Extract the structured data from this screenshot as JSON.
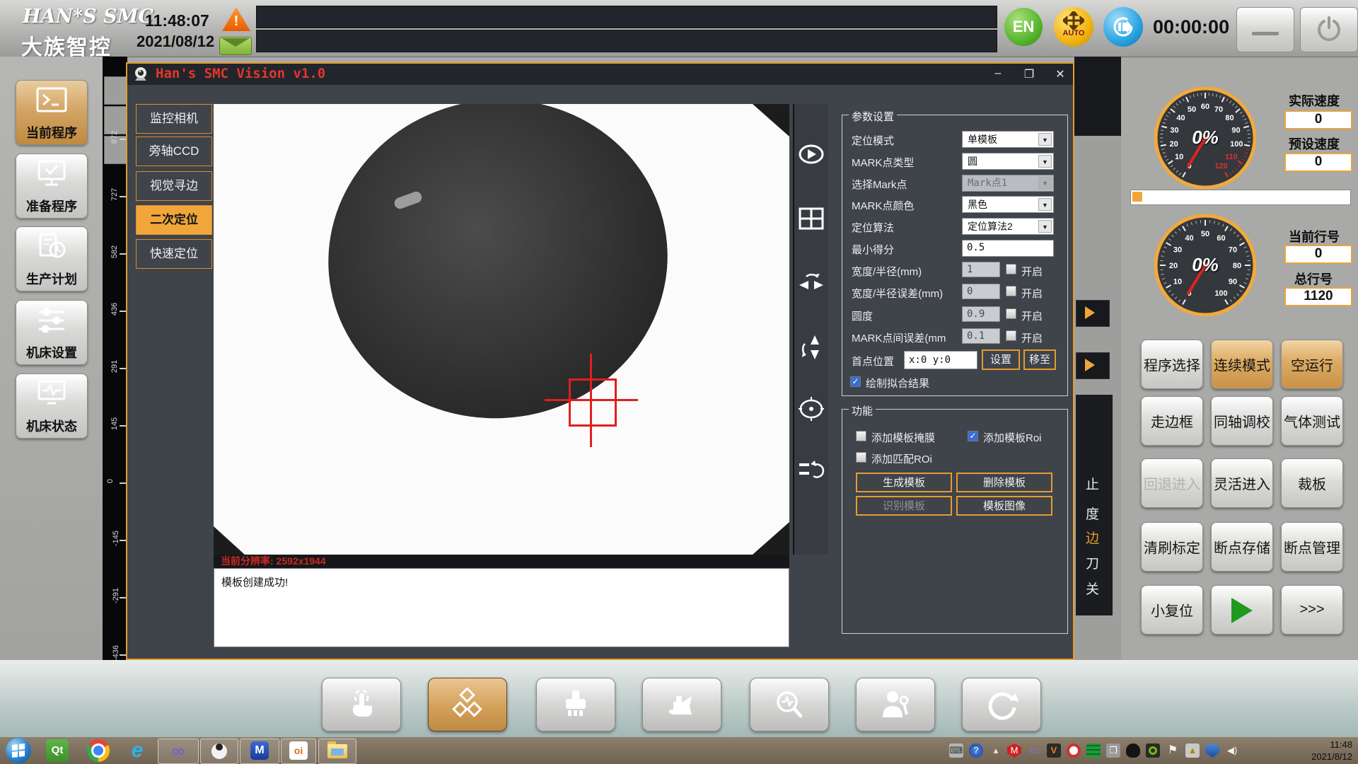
{
  "top_bar": {
    "logo_line1": "HAN*S SMC",
    "logo_line2": "大族智控",
    "time": "11:48:07",
    "date": "2021/08/12",
    "lang_button": "EN",
    "auto_label": "AUTO",
    "timer": "00:00:00"
  },
  "sidebar": {
    "items": [
      {
        "label": "当前程序",
        "icon": "terminal-icon",
        "active": true
      },
      {
        "label": "准备程序",
        "icon": "monitor-check-icon",
        "active": false
      },
      {
        "label": "生产计划",
        "icon": "plan-clock-icon",
        "active": false
      },
      {
        "label": "机床设置",
        "icon": "sliders-icon",
        "active": false
      },
      {
        "label": "机床状态",
        "icon": "monitor-pulse-icon",
        "active": false
      }
    ]
  },
  "left_ruler": {
    "values": [
      "872",
      "727",
      "582",
      "436",
      "291",
      "145",
      "0",
      "-145",
      "-291",
      "-436"
    ]
  },
  "dialog": {
    "title": "Han's SMC Vision v1.0",
    "window_buttons": {
      "minimize": "–",
      "maximize": "❐",
      "close": "✕"
    },
    "tabs": [
      {
        "label": "监控相机",
        "active": false
      },
      {
        "label": "旁轴CCD",
        "active": false
      },
      {
        "label": "视觉寻边",
        "active": false
      },
      {
        "label": "二次定位",
        "active": true
      },
      {
        "label": "快速定位",
        "active": false
      }
    ],
    "toolbar_icons": [
      "camera-play",
      "split-grid",
      "flip-horizontal",
      "flip-vertical",
      "target",
      "reset-view"
    ],
    "resolution_label": "当前分辨率: 2592x1944",
    "log_message": "模板创建成功!",
    "params": {
      "group_title": "参数设置",
      "dropdown_rows": [
        {
          "label": "定位模式",
          "value": "单模板",
          "disabled": false
        },
        {
          "label": "MARK点类型",
          "value": "圆",
          "disabled": false
        },
        {
          "label": "选择Mark点",
          "value": "Mark点1",
          "disabled": true
        },
        {
          "label": "MARK点颜色",
          "value": "黑色",
          "disabled": false
        },
        {
          "label": "定位算法",
          "value": "定位算法2",
          "disabled": false
        }
      ],
      "score_label": "最小得分",
      "score_value": "0.5",
      "numeric_rows": [
        {
          "label": "宽度/半径(mm)",
          "value": "1",
          "toggle": "开启",
          "checked": false
        },
        {
          "label": "宽度/半径误差(mm)",
          "value": "0",
          "toggle": "开启",
          "checked": false
        },
        {
          "label": "圆度",
          "value": "0.9",
          "toggle": "开启",
          "checked": false
        },
        {
          "label": "MARK点间误差(mm",
          "value": "0.1",
          "toggle": "开启",
          "checked": false
        }
      ],
      "first_point_label": "首点位置",
      "first_point_value": "x:0 y:0",
      "set_button": "设置",
      "move_button": "移至",
      "draw_fit_label": "绘制拟合结果",
      "draw_fit_checked": true
    },
    "functions": {
      "group_title": "功能",
      "cb_mask": {
        "label": "添加模板掩膜",
        "checked": false
      },
      "cb_roi": {
        "label": "添加模板Roi",
        "checked": true
      },
      "cb_match": {
        "label": "添加匹配ROi",
        "checked": false
      },
      "btn_generate": "生成模板",
      "btn_delete": "删除模板",
      "btn_recognize": "识别模板",
      "btn_image": "模板图像"
    }
  },
  "behind_strip": {
    "fragments": [
      "止",
      "度",
      "边",
      "刀",
      "关"
    ]
  },
  "machine_panel": {
    "gauge1": {
      "center_label": "0%",
      "ticks": [
        0,
        10,
        20,
        30,
        40,
        50,
        60,
        70,
        80,
        90,
        100,
        110,
        120
      ],
      "red_from": 110
    },
    "gauge2": {
      "center_label": "0%",
      "ticks": [
        0,
        10,
        20,
        30,
        40,
        50,
        60,
        70,
        80,
        90,
        100
      ],
      "red_from": 999
    },
    "actual_speed_label": "实际速度",
    "actual_speed_value": "0",
    "preset_speed_label": "预设速度",
    "preset_speed_value": "0",
    "current_line_label": "当前行号",
    "current_line_value": "0",
    "total_line_label": "总行号",
    "total_line_value": "1120",
    "buttons": [
      {
        "label": "程序选择",
        "state": "normal"
      },
      {
        "label": "连续模式",
        "state": "active"
      },
      {
        "label": "空运行",
        "state": "active"
      },
      {
        "label": "走边框",
        "state": "normal"
      },
      {
        "label": "同轴调校",
        "state": "normal"
      },
      {
        "label": "气体测试",
        "state": "normal"
      },
      {
        "label": "回退进入",
        "state": "disabled"
      },
      {
        "label": "灵活进入",
        "state": "normal"
      },
      {
        "label": "裁板",
        "state": "normal"
      },
      {
        "label": "清刷标定",
        "state": "normal"
      },
      {
        "label": "断点存储",
        "state": "normal"
      },
      {
        "label": "断点管理",
        "state": "normal"
      },
      {
        "label": "小复位",
        "state": "normal"
      },
      {
        "label": "",
        "state": "play"
      },
      {
        "label": ">>>",
        "state": "normal"
      }
    ]
  },
  "dock": {
    "icons": [
      "touch",
      "cubes",
      "brush",
      "oil-can",
      "diagnostics",
      "operator-tools",
      "reset"
    ],
    "active": "cubes"
  },
  "taskbar": {
    "qt_glyph": "Qt",
    "ie_glyph": "e",
    "vs_glyph": "∞",
    "blue_app_glyph": "M",
    "oi_glyph": "oi",
    "tray_icons": [
      "keyboard",
      "help",
      "overflow",
      "antivirus",
      "visual-studio",
      "v-app",
      "record",
      "network-grid",
      "windows-copy",
      "bird",
      "gpu",
      "flag",
      "action-center",
      "shield",
      "volume"
    ],
    "tray_time": "11:48",
    "tray_date": "2021/8/12"
  }
}
